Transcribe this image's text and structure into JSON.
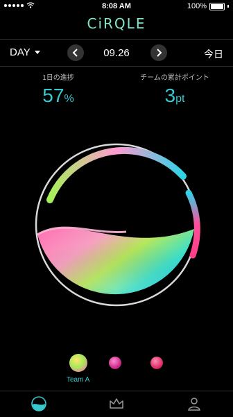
{
  "status": {
    "time": "8:08 AM",
    "battery": "100%"
  },
  "app": {
    "logo": "CiRQLE"
  },
  "nav": {
    "mode": "DAY",
    "date": "09.26",
    "today": "今日"
  },
  "stats": {
    "daily_progress": {
      "label": "1日の進捗",
      "value": "57",
      "unit": "%"
    },
    "team_points": {
      "label": "チームの累計ポイント",
      "value": "3",
      "unit": "pt"
    }
  },
  "teams": [
    {
      "name": "Team A"
    },
    {
      "name": ""
    },
    {
      "name": ""
    }
  ],
  "tabs": [
    {
      "icon": "progress-circle-icon"
    },
    {
      "icon": "crown-icon"
    },
    {
      "icon": "profile-icon"
    }
  ],
  "colors": {
    "accent": "#38c8d0",
    "background": "#000000"
  }
}
